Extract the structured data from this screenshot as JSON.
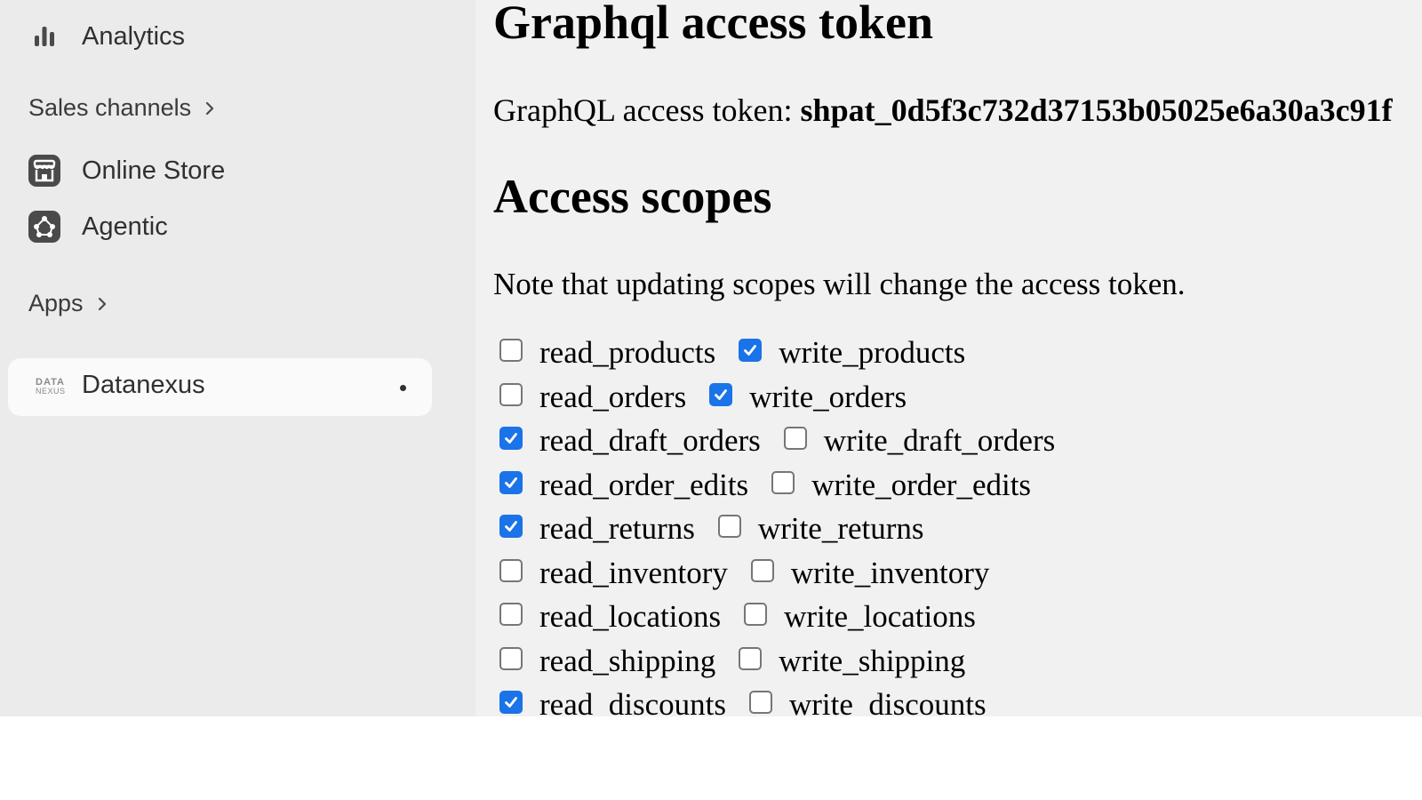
{
  "sidebar": {
    "analytics": {
      "label": "Analytics",
      "icon": "bar-chart-icon"
    },
    "sales_channels": {
      "label": "Sales channels",
      "icon": "chevron-right-icon"
    },
    "online_store": {
      "label": "Online Store",
      "icon": "store-icon"
    },
    "agentic": {
      "label": "Agentic",
      "icon": "agentic-icon"
    },
    "apps": {
      "label": "Apps",
      "icon": "chevron-right-icon"
    },
    "datanexus": {
      "label": "Datanexus",
      "logo_line1": "DATA",
      "logo_line2": "NEXUS",
      "icon": "datanexus-logo"
    }
  },
  "main": {
    "title": "Graphql access token",
    "token_label": "GraphQL access token:",
    "token_value": "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",
    "scopes_title": "Access scopes",
    "note": "Note that updating scopes will change the access token.",
    "scopes": [
      {
        "read": "read_products",
        "read_checked": false,
        "write": "write_products",
        "write_checked": true
      },
      {
        "read": "read_orders",
        "read_checked": false,
        "write": "write_orders",
        "write_checked": true
      },
      {
        "read": "read_draft_orders",
        "read_checked": true,
        "write": "write_draft_orders",
        "write_checked": false
      },
      {
        "read": "read_order_edits",
        "read_checked": true,
        "write": "write_order_edits",
        "write_checked": false
      },
      {
        "read": "read_returns",
        "read_checked": true,
        "write": "write_returns",
        "write_checked": false
      },
      {
        "read": "read_inventory",
        "read_checked": false,
        "write": "write_inventory",
        "write_checked": false
      },
      {
        "read": "read_locations",
        "read_checked": false,
        "write": "write_locations",
        "write_checked": false
      },
      {
        "read": "read_shipping",
        "read_checked": false,
        "write": "write_shipping",
        "write_checked": false
      },
      {
        "read": "read_discounts",
        "read_checked": true,
        "write": "write_discounts",
        "write_checked": false
      }
    ]
  },
  "colors": {
    "sidebar_bg": "#ebebeb",
    "main_bg": "#f1f1f1",
    "checkbox_checked": "#1a73e8"
  }
}
